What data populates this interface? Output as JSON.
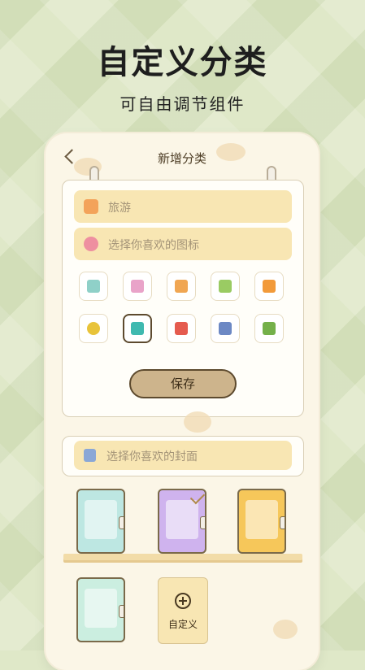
{
  "promo": {
    "headline": "自定义分类",
    "subline": "可自由调节组件"
  },
  "screen": {
    "title": "新增分类",
    "name_field": {
      "value": "旅游",
      "icon": "suitcase-icon"
    },
    "icon_field": {
      "placeholder": "选择你喜欢的图标",
      "icon": "heart-icon"
    },
    "icons": [
      {
        "name": "note-icon",
        "color": "#8fd0c8"
      },
      {
        "name": "shop-icon",
        "color": "#e9a3c9"
      },
      {
        "name": "bag-icon",
        "color": "#f0a653"
      },
      {
        "name": "gift-icon",
        "color": "#9acb63"
      },
      {
        "name": "document-icon",
        "color": "#f29a3a"
      },
      {
        "name": "search-icon",
        "color": "#e8c33a"
      },
      {
        "name": "backpack-icon",
        "color": "#3fb9b0",
        "selected": true
      },
      {
        "name": "book-icon",
        "color": "#e55b4f"
      },
      {
        "name": "map-icon",
        "color": "#6c88c4"
      },
      {
        "name": "house-icon",
        "color": "#74b04a"
      }
    ],
    "save_label": "保存",
    "cover_field": {
      "placeholder": "选择你喜欢的封面",
      "icon": "cover-icon"
    },
    "covers": [
      {
        "name": "cover-girl-reading",
        "color": "#bde7e2"
      },
      {
        "name": "cover-boy-desk",
        "color": "#cfb3ee",
        "selected": true
      },
      {
        "name": "cover-boy-computer",
        "color": "#f6c75a"
      },
      {
        "name": "cover-christmas",
        "color": "#cbeee0"
      }
    ],
    "custom_label": "自定义"
  }
}
